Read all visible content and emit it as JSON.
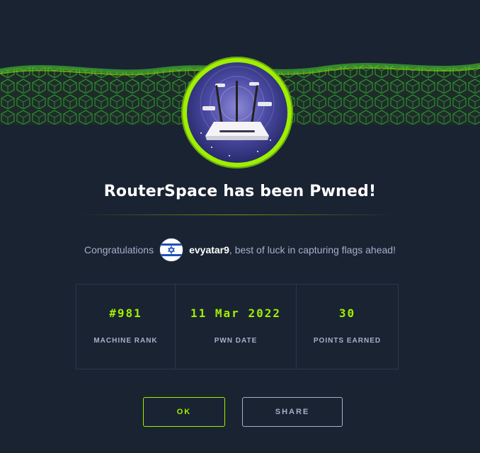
{
  "header": {
    "title": "RouterSpace has been Pwned!"
  },
  "congrats": {
    "lead": "Congratulations",
    "username": "evyatar9",
    "message": ", best of luck in capturing flags ahead!"
  },
  "stats": [
    {
      "value": "#981",
      "label": "MACHINE RANK"
    },
    {
      "value": "11 Mar 2022",
      "label": "PWN DATE"
    },
    {
      "value": "30",
      "label": "POINTS EARNED"
    }
  ],
  "buttons": {
    "ok_label": "OK",
    "share_label": "SHARE"
  },
  "icons": {
    "machine_avatar": "router-icon",
    "user_flag": "israel-flag-icon"
  },
  "colors": {
    "background": "#1a2332",
    "accent": "#9fef00",
    "muted_text": "#a4b1cd",
    "border": "#2a374d"
  }
}
